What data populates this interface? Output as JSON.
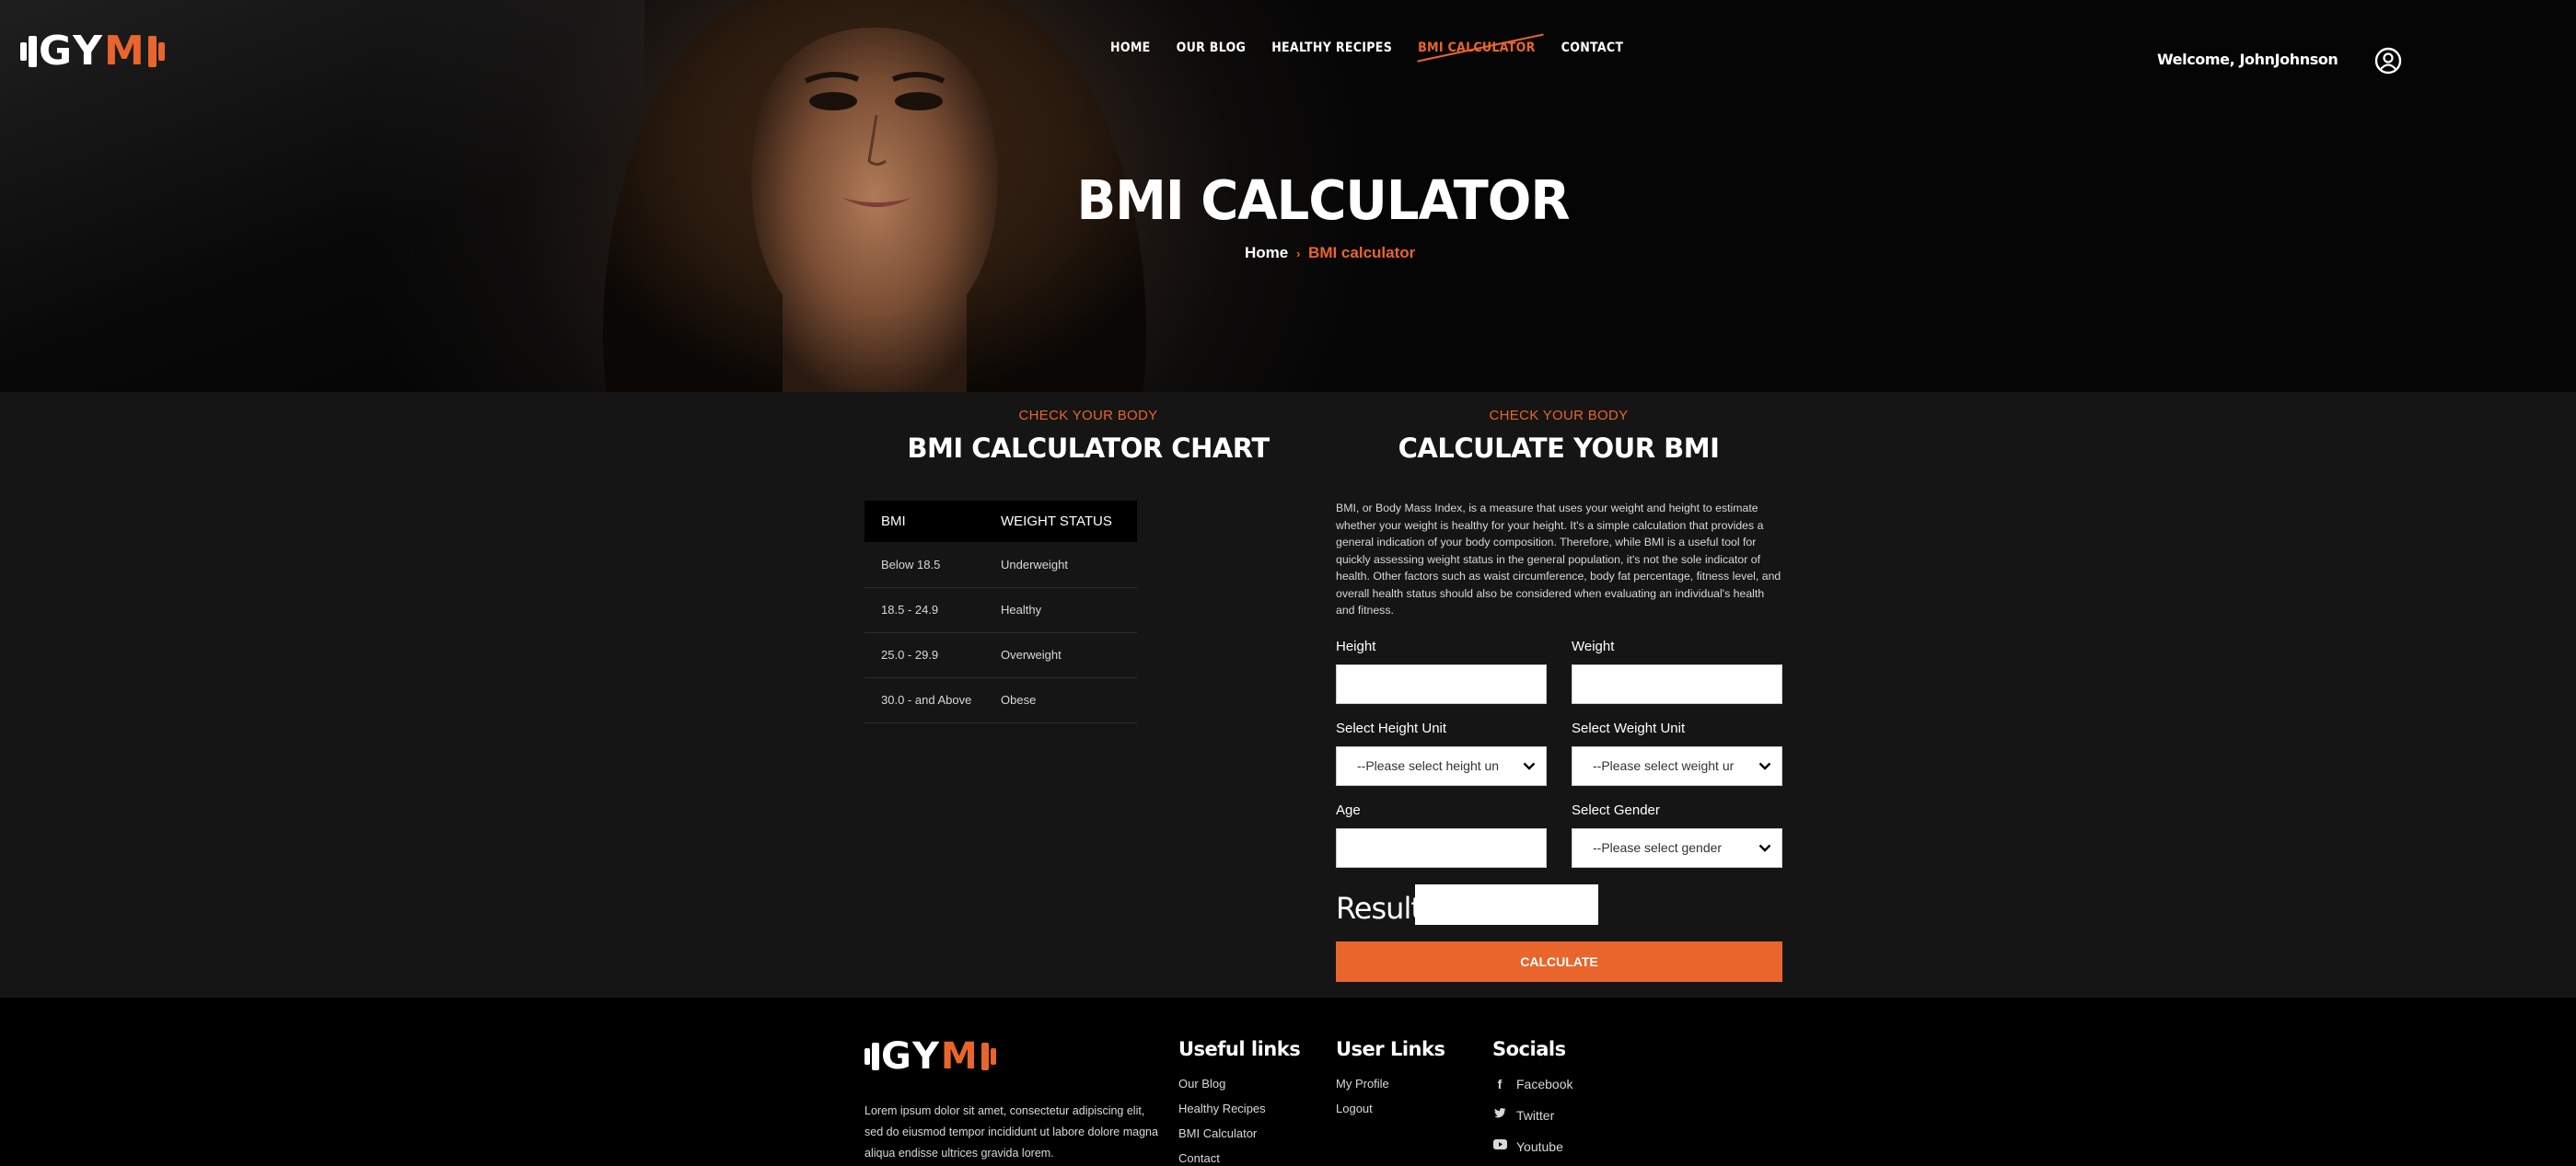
{
  "brand": {
    "logo_left": "GY",
    "logo_accent": "M"
  },
  "nav": {
    "items": [
      {
        "label": "HOME",
        "active": false
      },
      {
        "label": "OUR BLOG",
        "active": false
      },
      {
        "label": "HEALTHY RECIPES",
        "active": false
      },
      {
        "label": "BMI CALCULATOR",
        "active": true
      },
      {
        "label": "CONTACT",
        "active": false
      }
    ]
  },
  "header": {
    "welcome": "Welcome, JohnJohnson"
  },
  "hero": {
    "title": "BMI CALCULATOR",
    "breadcrumb_home": "Home",
    "breadcrumb_sep": "›",
    "breadcrumb_current": "BMI calculator"
  },
  "chart_section": {
    "eyebrow": "CHECK YOUR BODY",
    "title": "BMI CALCULATOR CHART",
    "columns": [
      "BMI",
      "WEIGHT STATUS"
    ],
    "rows": [
      [
        "Below 18.5",
        "Underweight"
      ],
      [
        "18.5 - 24.9",
        "Healthy"
      ],
      [
        "25.0 - 29.9",
        "Overweight"
      ],
      [
        "30.0 - and Above",
        "Obese"
      ]
    ]
  },
  "form_section": {
    "eyebrow": "CHECK YOUR BODY",
    "title": "CALCULATE YOUR BMI",
    "description": "BMI, or Body Mass Index, is a measure that uses your weight and height to estimate whether your weight is healthy for your height. It's a simple calculation that provides a general indication of your body composition. Therefore, while BMI is a useful tool for quickly assessing weight status in the general population, it's not the sole indicator of health. Other factors such as waist circumference, body fat percentage, fitness level, and overall health status should also be considered when evaluating an individual's health and fitness.",
    "height_label": "Height",
    "weight_label": "Weight",
    "height_value": "",
    "weight_value": "",
    "height_unit_label": "Select Height Unit",
    "height_unit_value": "--Please select height un",
    "weight_unit_label": "Select Weight Unit",
    "weight_unit_value": "--Please select weight ur",
    "age_label": "Age",
    "age_value": "",
    "gender_label": "Select Gender",
    "gender_value": "--Please select gender",
    "result_label": "Result:",
    "result_value": "",
    "calculate_label": "CALCULATE"
  },
  "footer": {
    "about": "Lorem ipsum dolor sit amet, consectetur adipiscing elit, sed do eiusmod tempor incididunt ut labore dolore magna aliqua endisse ultrices gravida lorem.",
    "useful_title": "Useful links",
    "useful_links": [
      "Our Blog",
      "Healthy Recipes",
      "BMI Calculator",
      "Contact"
    ],
    "user_title": "User Links",
    "user_links": [
      "My Profile",
      "Logout"
    ],
    "socials_title": "Socials",
    "socials": [
      {
        "label": "Facebook",
        "icon": "facebook-icon"
      },
      {
        "label": "Twitter",
        "icon": "twitter-icon"
      },
      {
        "label": "Youtube",
        "icon": "youtube-icon"
      }
    ]
  },
  "colors": {
    "accent": "#e8652b",
    "background": "#151515",
    "footer": "#000000"
  }
}
